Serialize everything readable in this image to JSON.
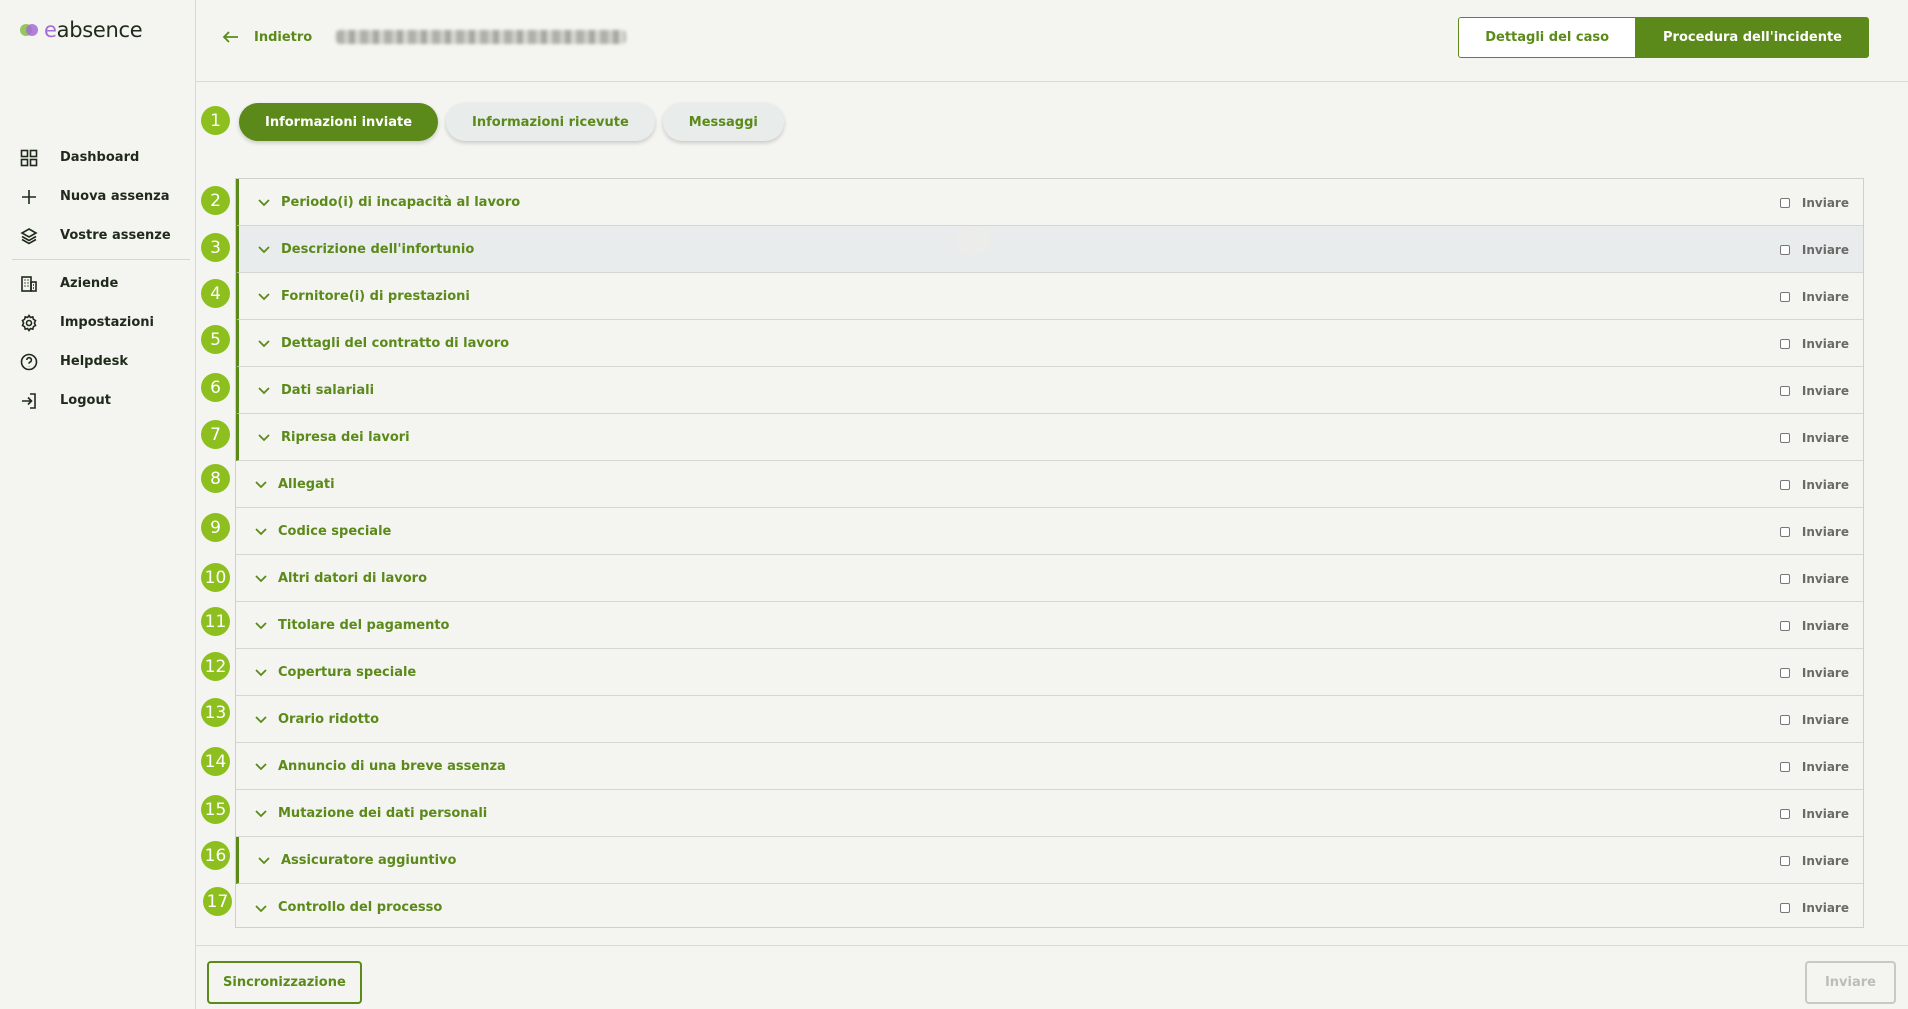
{
  "brand": {
    "logo_prefix": "e",
    "logo_rest": "absence",
    "accent": "#5b8a1a",
    "badge": "#8dbf1f",
    "logo_dot_green": "#8bc34a",
    "logo_dot_purple": "#a56bd6"
  },
  "sidebar": {
    "items": [
      {
        "label": "Dashboard",
        "icon": "grid-icon"
      },
      {
        "label": "Nuova assenza",
        "icon": "plus-icon"
      },
      {
        "label": "Vostre assenze",
        "icon": "layers-icon"
      },
      {
        "label": "Aziende",
        "icon": "building-icon"
      },
      {
        "label": "Impostazioni",
        "icon": "gear-icon"
      },
      {
        "label": "Helpdesk",
        "icon": "help-circle-icon"
      },
      {
        "label": "Logout",
        "icon": "logout-icon"
      }
    ]
  },
  "header": {
    "back_label": "Indietro",
    "case_details_label": "Dettagli del caso",
    "incident_procedure_label": "Procedura dell'incidente"
  },
  "tabs": [
    {
      "label": "Informazioni inviate",
      "active": true
    },
    {
      "label": "Informazioni ricevute",
      "active": false
    },
    {
      "label": "Messaggi",
      "active": false
    }
  ],
  "steps": [
    "1",
    "2",
    "3",
    "4",
    "5",
    "6",
    "7",
    "8",
    "9",
    "10",
    "11",
    "12",
    "13",
    "14",
    "15",
    "16",
    "17"
  ],
  "send_label": "Inviare",
  "sections": [
    {
      "title": "Periodo(i) di incapacità al lavoro"
    },
    {
      "title": "Descrizione dell'infortunio"
    },
    {
      "title": "Fornitore(i) di prestazioni"
    },
    {
      "title": "Dettagli del contratto di lavoro"
    },
    {
      "title": "Dati salariali"
    },
    {
      "title": "Ripresa dei lavori"
    },
    {
      "title": "Allegati"
    },
    {
      "title": "Codice speciale"
    },
    {
      "title": "Altri datori di lavoro"
    },
    {
      "title": "Titolare del pagamento"
    },
    {
      "title": "Copertura speciale"
    },
    {
      "title": "Orario ridotto"
    },
    {
      "title": "Annuncio di una breve assenza"
    },
    {
      "title": "Mutazione dei dati personali"
    },
    {
      "title": "Assicuratore aggiuntivo"
    },
    {
      "title": "Controllo del processo"
    }
  ],
  "footer": {
    "sync_label": "Sincronizzazione",
    "send_label": "Inviare"
  }
}
